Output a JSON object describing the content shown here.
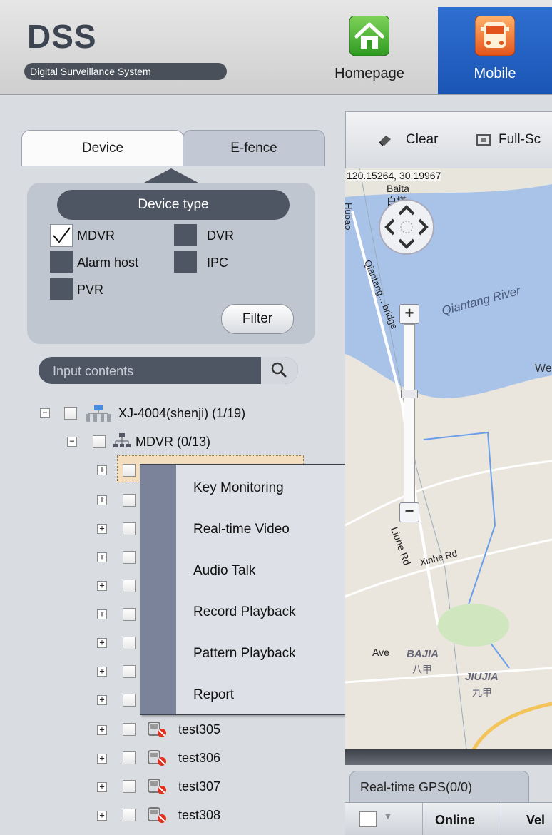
{
  "header": {
    "logo": "DSS",
    "subtitle": "Digital Surveillance System",
    "nav": [
      {
        "label": "Homepage",
        "icon": "home-icon"
      },
      {
        "label": "Mobile",
        "icon": "bus-icon"
      }
    ]
  },
  "left_panel": {
    "tabs": [
      "Device",
      "E-fence"
    ],
    "device_type_label": "Device type",
    "device_types": [
      {
        "label": "MDVR",
        "checked": true
      },
      {
        "label": "DVR",
        "checked": false
      },
      {
        "label": "Alarm host",
        "checked": false
      },
      {
        "label": "IPC",
        "checked": false
      },
      {
        "label": "PVR",
        "checked": false
      }
    ],
    "filter_label": "Filter",
    "search_placeholder": "Input contents"
  },
  "tree": {
    "root": "XJ-4004(shenji) (1/19)",
    "group": "MDVR (0/13)",
    "visible_devices": [
      "test305",
      "test306",
      "test307",
      "test308"
    ]
  },
  "context_menu": {
    "items": [
      {
        "label": "Key Monitoring",
        "submenu": false
      },
      {
        "label": "Real-time Video",
        "submenu": true
      },
      {
        "label": "Audio Talk",
        "submenu": false
      },
      {
        "label": "Record Playback",
        "submenu": false
      },
      {
        "label": "Pattern Playback",
        "submenu": false
      },
      {
        "label": "Report",
        "submenu": true
      }
    ]
  },
  "map": {
    "toolbar": [
      "Clear",
      "Full-Sc"
    ],
    "coordinates": "120.15264, 30.19967",
    "labels": {
      "baita": "Baita",
      "baita_cn": "白塔",
      "hupao": "Hupao",
      "bridge": "Qiantang... bridge",
      "river": "Qiantang River",
      "we": "We",
      "liuhe": "Liuhe Rd",
      "xinhe": "Xinhe Rd",
      "ave": "Ave",
      "bajia": "BAJIA",
      "bajia_cn": "八甲",
      "jiujia": "JIUJIA",
      "jiujia_cn": "九甲"
    },
    "zoom_in": "+",
    "zoom_out": "−"
  },
  "gps": {
    "tab": "Real-time GPS(0/0)",
    "columns": [
      "Online",
      "Vel"
    ]
  },
  "colors": {
    "accent": "#1a55b5",
    "panel": "#c0c6d0",
    "dark": "#4f5663",
    "menu_strip": "#7b839a"
  }
}
